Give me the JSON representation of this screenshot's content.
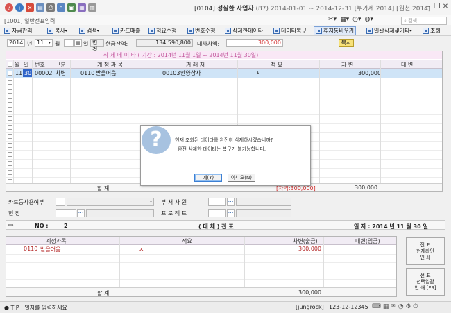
{
  "app": {
    "company_code": "[0104]",
    "company_name": "성실한 사업자",
    "meta": "(87) 2014-01-01 ~ 2014-12-31 [부가세 2014] [원천 2014]",
    "screen_title": "[1001] 일반전표입력",
    "search_placeholder": "검색"
  },
  "menu": [
    {
      "label": "자금관리",
      "icon": "money-icon"
    },
    {
      "label": "복사",
      "icon": "copy-icon",
      "dropdown": true
    },
    {
      "label": "검색",
      "icon": "search-icon",
      "dropdown": true
    },
    {
      "label": "카드매출",
      "icon": "card-icon"
    },
    {
      "label": "적요수정",
      "icon": "edit-icon"
    },
    {
      "label": "번호수정",
      "icon": "number-icon"
    },
    {
      "label": "삭제한데이타",
      "icon": "deleted-data-icon"
    },
    {
      "label": "데이타복구",
      "icon": "restore-icon"
    },
    {
      "label": "휴지통비우기",
      "icon": "trash-icon",
      "active": true
    },
    {
      "label": "일괄삭제및기타",
      "icon": "bulk-delete-icon",
      "dropdown": true
    },
    {
      "label": "조회",
      "icon": "refresh-icon"
    }
  ],
  "filter": {
    "year": "2014",
    "year_label": "년",
    "month": "11",
    "month_label": "월",
    "day_label": "일",
    "change_btn": "변경",
    "cash_label": "현금잔액:",
    "cash_value": "134,590,800",
    "diff_label": "대차차액:",
    "diff_value": "300,000",
    "copy_btn": "복사"
  },
  "grid": {
    "caption": "삭 제 데 이 타   ( 기간 : 2014년 11월 1일 ~ 2014년 11월 30일)",
    "headers": [
      "월",
      "일",
      "번호",
      "구분",
      "계 정 과 목",
      "거 래 처",
      "적 요",
      "차 변",
      "대 변"
    ],
    "row": {
      "month": "11",
      "day": "30",
      "no": "00002",
      "type": "차변",
      "acct_code": "0110",
      "acct_name": "받을어음",
      "client_code": "00103",
      "client_name": "안양상사",
      "memo": "ㅅ",
      "debit": "300,000",
      "credit": ""
    },
    "footer_label": "합     계",
    "footer_diff": "[차익:300,000]",
    "footer_debit": "300,000"
  },
  "dialog": {
    "message1": "현재 조회된 데이타를 완전히 삭제하시겠습니까?",
    "message2": "완전 삭제한 데이타는 복구가 불가능합니다.",
    "yes": "예(Y)",
    "no": "아니오(N)"
  },
  "info": {
    "card_label": "카드등사용여부",
    "dept_label": "부  서  사  원",
    "site_label": "현          장",
    "project_label": "프  로  젝  트"
  },
  "voucher": {
    "no_label": "NO :",
    "no_value": "2",
    "title": "( 대 체 )  전  표",
    "date_label": "일 자 : 2014 년 11 월 30 일",
    "headers": [
      "계정과목",
      "적요",
      "차변(출금)",
      "대변(입금)"
    ],
    "row": {
      "acct_code": "0110",
      "acct_name": "받을어음",
      "memo": "ㅅ",
      "debit": "300,000"
    },
    "footer_label": "합           계",
    "footer_debit": "300,000"
  },
  "side_buttons": [
    {
      "label": "전 표\n현재라인\n인 쇄"
    },
    {
      "label": "전 표\n선택일괄\n인 쇄 [F9]"
    }
  ],
  "status": {
    "tip": "TIP : 일자를 입력하세요",
    "user": "[jungrock]",
    "phone": "123-12-12345"
  }
}
